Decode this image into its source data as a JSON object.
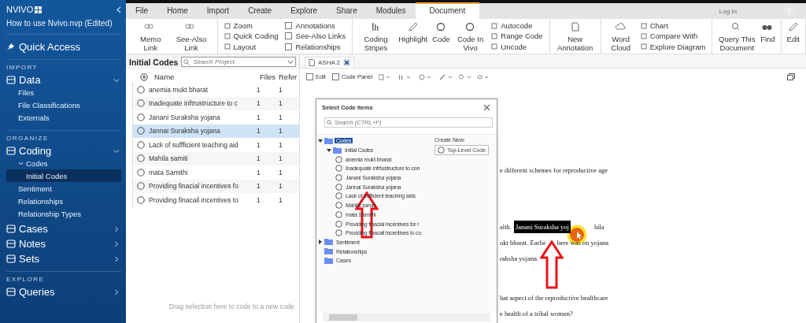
{
  "sidebar": {
    "logo": "NVIVO",
    "project": "How to use Nvivo.nvp (Edited)",
    "quick_access": "Quick Access",
    "sections": [
      {
        "heading": "IMPORT",
        "groups": [
          {
            "label": "Data",
            "expanded": true,
            "children": [
              {
                "label": "Files",
                "selected": false
              },
              {
                "label": "File Classifications",
                "selected": false
              },
              {
                "label": "Externals",
                "selected": false
              }
            ]
          }
        ]
      },
      {
        "heading": "ORGANIZE",
        "groups": [
          {
            "label": "Coding",
            "expanded": true,
            "children": [
              {
                "label": "Codes",
                "selected": false,
                "expanded": true,
                "children": [
                  {
                    "label": "Initial Codes",
                    "selected": true
                  }
                ]
              },
              {
                "label": "Sentiment",
                "selected": false
              },
              {
                "label": "Relationships",
                "selected": false
              },
              {
                "label": "Relationship Types",
                "selected": false
              }
            ]
          },
          {
            "label": "Cases",
            "expanded": false
          },
          {
            "label": "Notes",
            "expanded": false
          },
          {
            "label": "Sets",
            "expanded": false
          }
        ]
      },
      {
        "heading": "EXPLORE",
        "groups": [
          {
            "label": "Queries",
            "expanded": false
          }
        ]
      }
    ]
  },
  "ribbon": {
    "tabs": [
      {
        "label": "File",
        "selected": false
      },
      {
        "label": "Home",
        "selected": false
      },
      {
        "label": "Import",
        "selected": false
      },
      {
        "label": "Create",
        "selected": false
      },
      {
        "label": "Explore",
        "selected": false
      },
      {
        "label": "Share",
        "selected": false
      },
      {
        "label": "Modules",
        "selected": false
      },
      {
        "label": "Document",
        "selected": true
      }
    ],
    "login": "Log In",
    "groups": [
      {
        "columns": [
          {
            "kind": "large",
            "label": "Memo Link"
          },
          {
            "kind": "large",
            "label": "See-Also Link"
          }
        ]
      },
      {
        "columns": [
          {
            "kind": "stack",
            "items": [
              {
                "kind": "small",
                "label": "Zoom"
              },
              {
                "kind": "small",
                "label": "Quick Coding"
              },
              {
                "kind": "small",
                "label": "Layout"
              }
            ]
          },
          {
            "kind": "stack",
            "items": [
              {
                "kind": "check",
                "label": "Annotations",
                "checked": false
              },
              {
                "kind": "check",
                "label": "See-Also Links",
                "checked": false
              },
              {
                "kind": "check",
                "label": "Relationships",
                "checked": false
              }
            ]
          }
        ]
      },
      {
        "columns": [
          {
            "kind": "large",
            "label": "Coding Stripes"
          },
          {
            "kind": "large",
            "label": "Highlight"
          },
          {
            "kind": "large",
            "label": "Code"
          },
          {
            "kind": "large",
            "label": "Code In Vivo"
          },
          {
            "kind": "stack",
            "items": [
              {
                "kind": "small",
                "label": "Autocode"
              },
              {
                "kind": "small",
                "label": "Range Code"
              },
              {
                "kind": "small",
                "label": "Uncode"
              }
            ]
          }
        ]
      },
      {
        "columns": [
          {
            "kind": "large",
            "label": "New Annotation"
          }
        ]
      },
      {
        "columns": [
          {
            "kind": "large",
            "label": "Word Cloud"
          },
          {
            "kind": "stack",
            "items": [
              {
                "kind": "small",
                "label": "Chart"
              },
              {
                "kind": "small",
                "label": "Compare With"
              },
              {
                "kind": "small",
                "label": "Explore Diagram"
              }
            ]
          }
        ]
      },
      {
        "columns": [
          {
            "kind": "large",
            "label": "Query This Document"
          },
          {
            "kind": "large",
            "label": "Find"
          }
        ]
      },
      {
        "columns": [
          {
            "kind": "large",
            "label": "Edit"
          }
        ]
      }
    ]
  },
  "codes_panel": {
    "title": "Initial Codes",
    "search": {
      "placeholder": "Search Project"
    },
    "columns": [
      "Name",
      "Files",
      "Refer"
    ],
    "rows": [
      {
        "name": "anemia mukt bharat",
        "files": "1",
        "refs": "1",
        "selected": false
      },
      {
        "name": "Inadequate inftrustructure to c",
        "files": "1",
        "refs": "1",
        "selected": false
      },
      {
        "name": "Janani Suraksha yojana",
        "files": "1",
        "refs": "1",
        "selected": false
      },
      {
        "name": "Jannai Suraksha yojana",
        "files": "1",
        "refs": "1",
        "selected": true
      },
      {
        "name": "Lack of suffficient  teaching aid",
        "files": "1",
        "refs": "1",
        "selected": false
      },
      {
        "name": "Mahila samiti",
        "files": "1",
        "refs": "1",
        "selected": false
      },
      {
        "name": "mata Samithi",
        "files": "1",
        "refs": "1",
        "selected": false
      },
      {
        "name": "Providing  finacial incentives fo",
        "files": "1",
        "refs": "1",
        "selected": false
      },
      {
        "name": "Providing finacail incentives to",
        "files": "1",
        "refs": "1",
        "selected": false
      }
    ],
    "footer": "Drag selection here to code to a new code"
  },
  "document": {
    "tab": "ASHA 2",
    "toolbar": [
      {
        "label": "Edit",
        "checked": false
      },
      {
        "label": "Code Panel",
        "checked": false
      }
    ],
    "paragraphs": [
      {
        "lines": [
          [
            {
              "text": "e different schemes for reproductive age",
              "highlighted": false
            }
          ]
        ]
      },
      {
        "lines": [
          [
            {
              "text": "alth.",
              "highlighted": false
            },
            {
              "text": "Janani Suraksha yoj",
              "highlighted": true
            },
            {
              "text": "hila",
              "highlighted": false
            }
          ],
          [
            {
              "text": "ukt bharat. Earlie",
              "highlighted": false
            },
            {
              "text": "here was on yojana",
              "highlighted": false
            }
          ],
          [
            {
              "text": "raksha yojana.",
              "highlighted": false
            }
          ]
        ]
      },
      {
        "lines": [
          [
            {
              "text": "hat aspect of the reproductive healthcare",
              "highlighted": false
            }
          ],
          [
            {
              "text": "e health of a tribal women?",
              "highlighted": false
            }
          ]
        ]
      }
    ]
  },
  "dialog": {
    "title": "Select Code Items",
    "search": {
      "placeholder": "Search (CTRL+F)"
    },
    "create_new": "Create New:",
    "top_level": "Top-Level Code",
    "tree": [
      {
        "label": "Codes",
        "kind": "folder",
        "selected": true,
        "expanded": true,
        "children": [
          {
            "label": "Initial Codes",
            "kind": "folder",
            "selected": false,
            "expanded": true,
            "children": [
              {
                "label": "anemia mukt bharat",
                "kind": "code",
                "selected": false
              },
              {
                "label": "Inadequate infrtustructure to con",
                "kind": "code",
                "selected": false
              },
              {
                "label": "Janani Suraksha yojana",
                "kind": "code",
                "selected": false
              },
              {
                "label": "Jannai Suraksha yojana",
                "kind": "code",
                "selected": false
              },
              {
                "label": "Lack of sufficient  teaching aids",
                "kind": "code",
                "selected": false
              },
              {
                "label": "Mahila samiti",
                "kind": "code",
                "selected": false
              },
              {
                "label": "mata Samithi",
                "kind": "code",
                "selected": false
              },
              {
                "label": "Providing finacial incentives for r",
                "kind": "code",
                "selected": false
              },
              {
                "label": "Providing finacail incentives to co",
                "kind": "code",
                "selected": false
              }
            ]
          }
        ]
      },
      {
        "label": "Sentiment",
        "kind": "folder",
        "selected": false,
        "expanded": false
      },
      {
        "label": "Relationships",
        "kind": "folder",
        "selected": false
      },
      {
        "label": "Cases",
        "kind": "folder",
        "selected": false
      }
    ]
  }
}
